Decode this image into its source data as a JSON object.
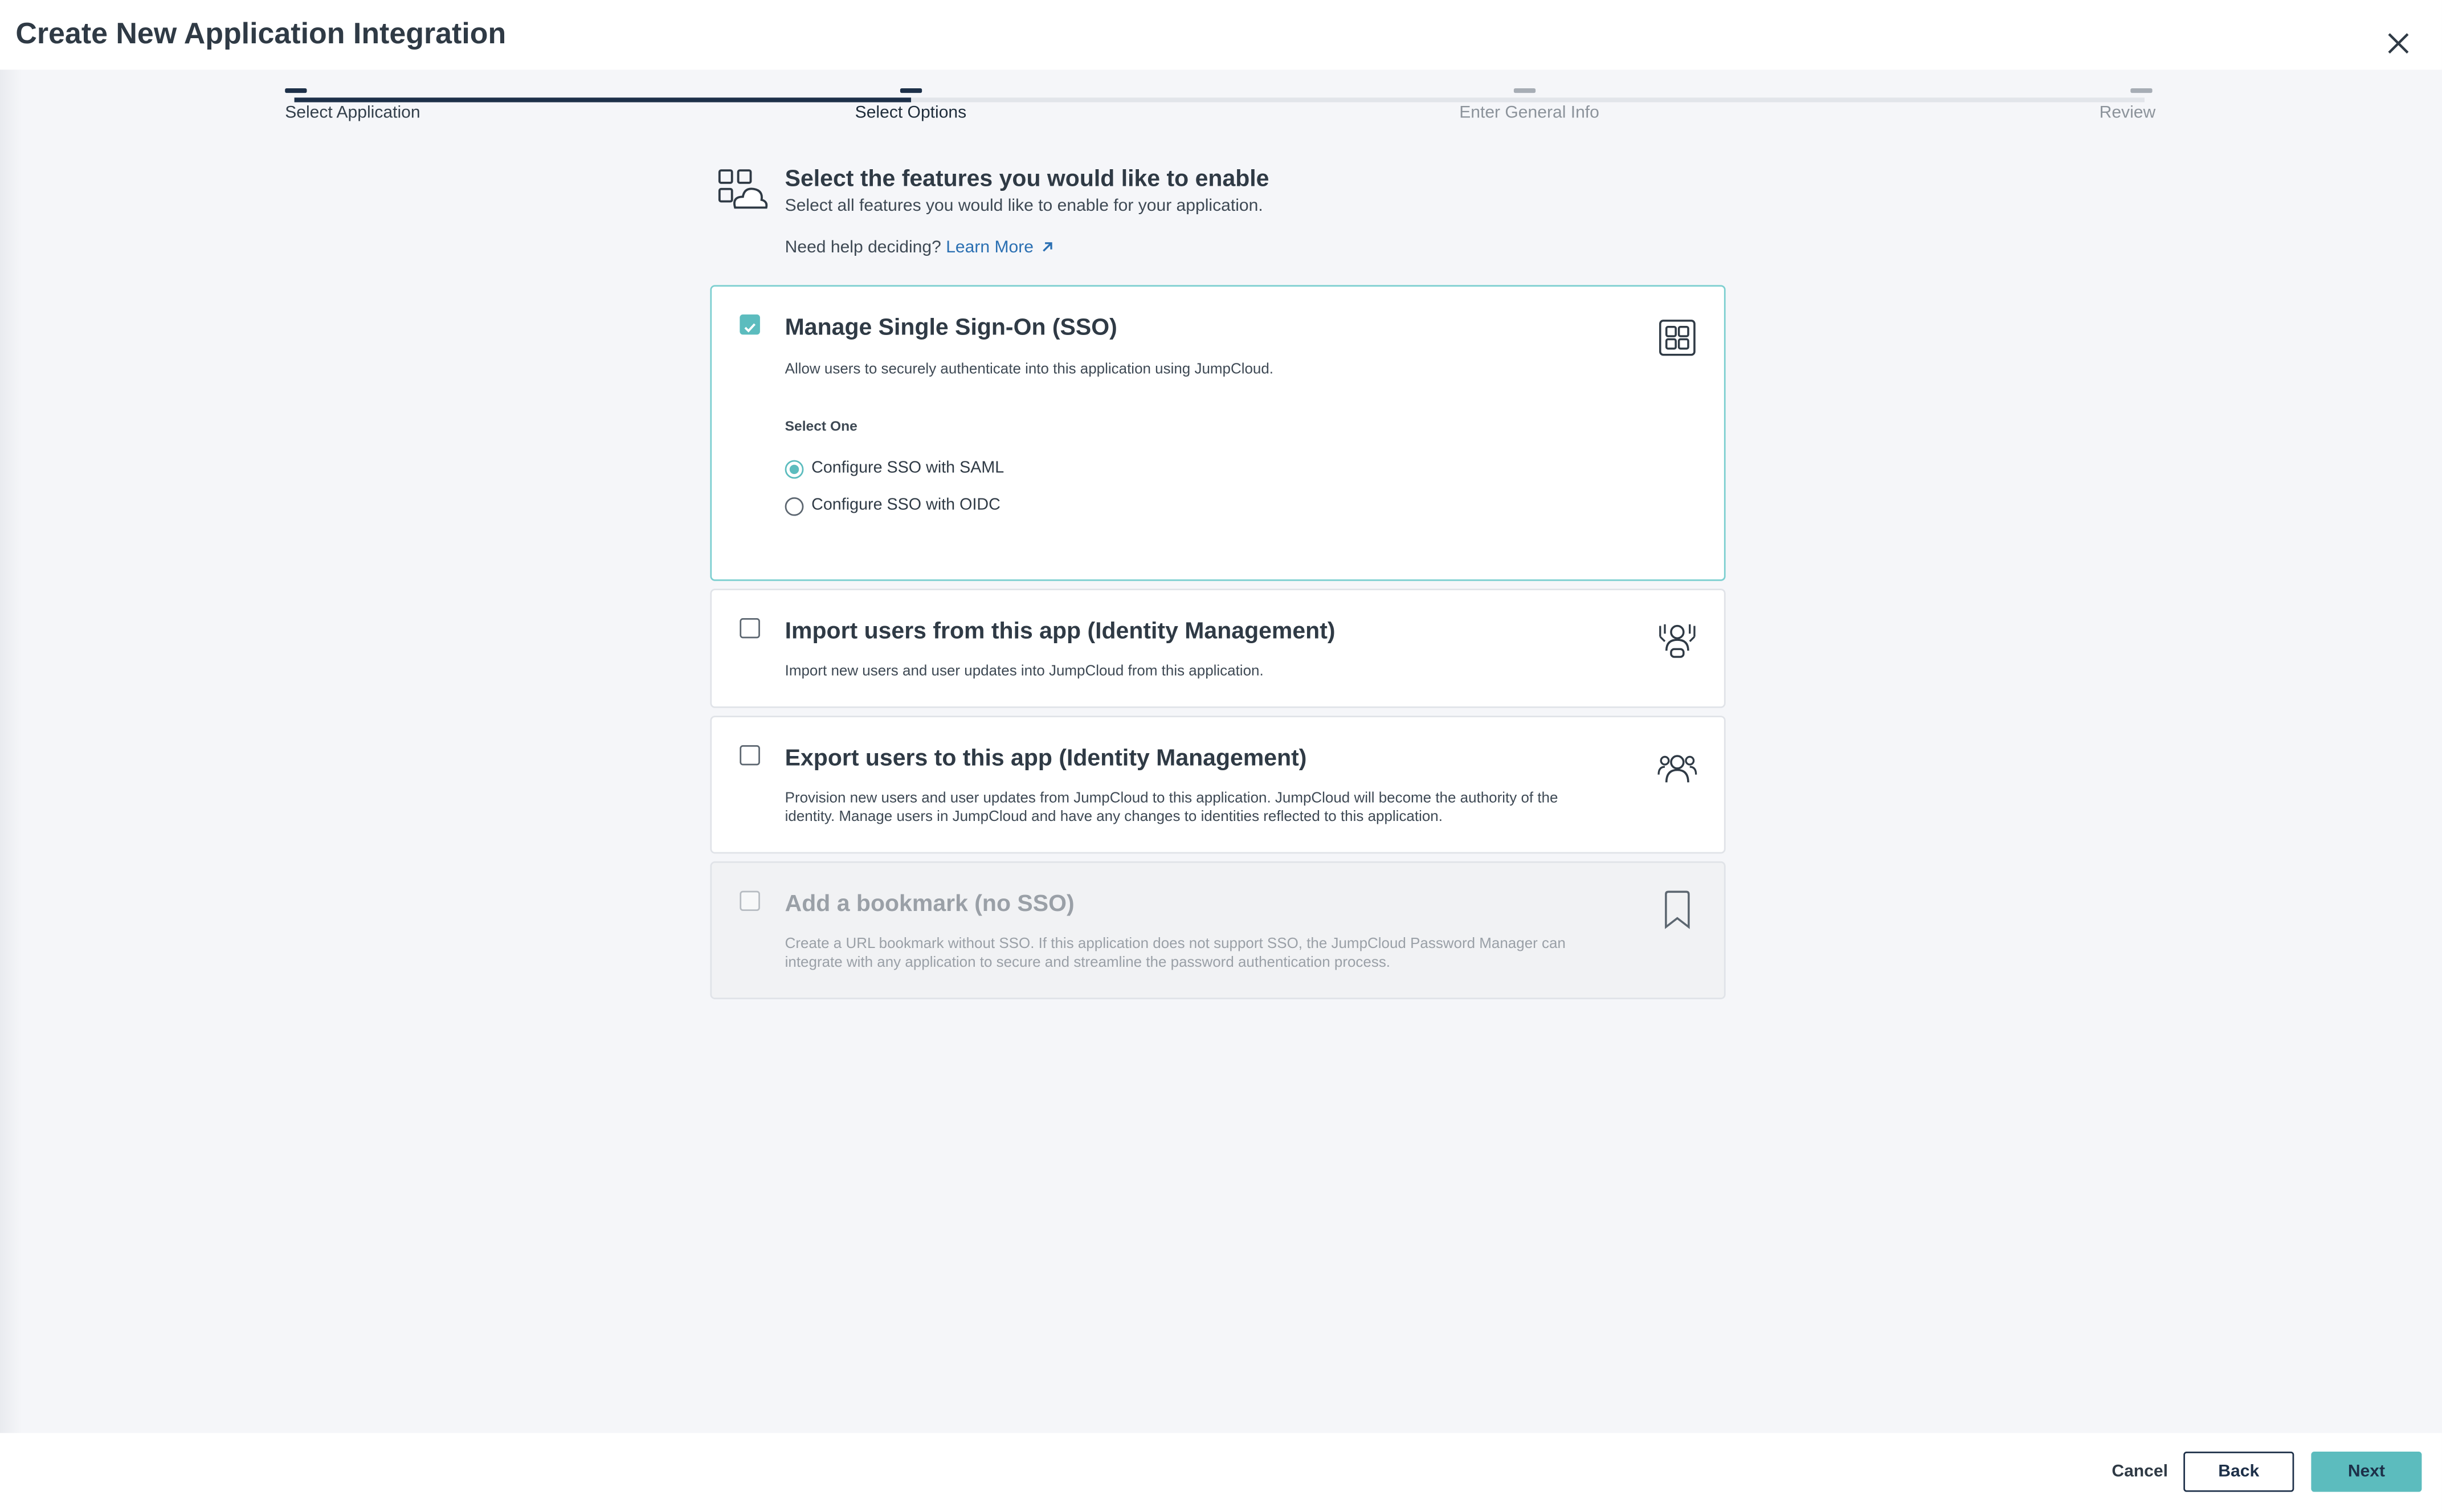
{
  "header": {
    "title": "Create New Application Integration",
    "close_icon": "close-icon"
  },
  "stepper": {
    "steps": [
      {
        "label": "Select Application",
        "state": "complete"
      },
      {
        "label": "Select Options",
        "state": "current"
      },
      {
        "label": "Enter General Info",
        "state": "upcoming"
      },
      {
        "label": "Review",
        "state": "upcoming"
      }
    ]
  },
  "intro": {
    "icon": "apps-cloud-icon",
    "title": "Select the features you would like to enable",
    "subtitle": "Select all features you would like to enable for your application.",
    "help_prefix": "Need help deciding?",
    "help_link": "Learn More"
  },
  "features": [
    {
      "title": "Manage Single Sign-On (SSO)",
      "description": "Allow users to securely authenticate into this application using JumpCloud.",
      "checked": true,
      "icon": "sso-grid-icon",
      "select_one_label": "Select One",
      "options": [
        {
          "label": "Configure SSO with SAML",
          "selected": true
        },
        {
          "label": "Configure SSO with OIDC",
          "selected": false
        }
      ]
    },
    {
      "title": "Import users from this app (Identity Management)",
      "description": "Import new users and user updates into JumpCloud from this application.",
      "checked": false,
      "icon": "import-users-icon"
    },
    {
      "title": "Export users to this app (Identity Management)",
      "description": "Provision new users and user updates from JumpCloud to this application. JumpCloud will become the authority of the identity. Manage users in JumpCloud and have any changes to identities reflected to this application.",
      "checked": false,
      "icon": "export-users-icon"
    },
    {
      "title": "Add a bookmark (no SSO)",
      "description": "Create a URL bookmark without SSO. If this application does not support SSO, the JumpCloud Password Manager can integrate with any application to secure and streamline the password authentication process.",
      "checked": false,
      "disabled": true,
      "icon": "bookmark-icon"
    }
  ],
  "footer": {
    "cancel_label": "Cancel",
    "back_label": "Back",
    "next_label": "Next"
  },
  "colors": {
    "accent": "#5cbcbe",
    "navy": "#1d3049",
    "link": "#2a6fb2"
  }
}
